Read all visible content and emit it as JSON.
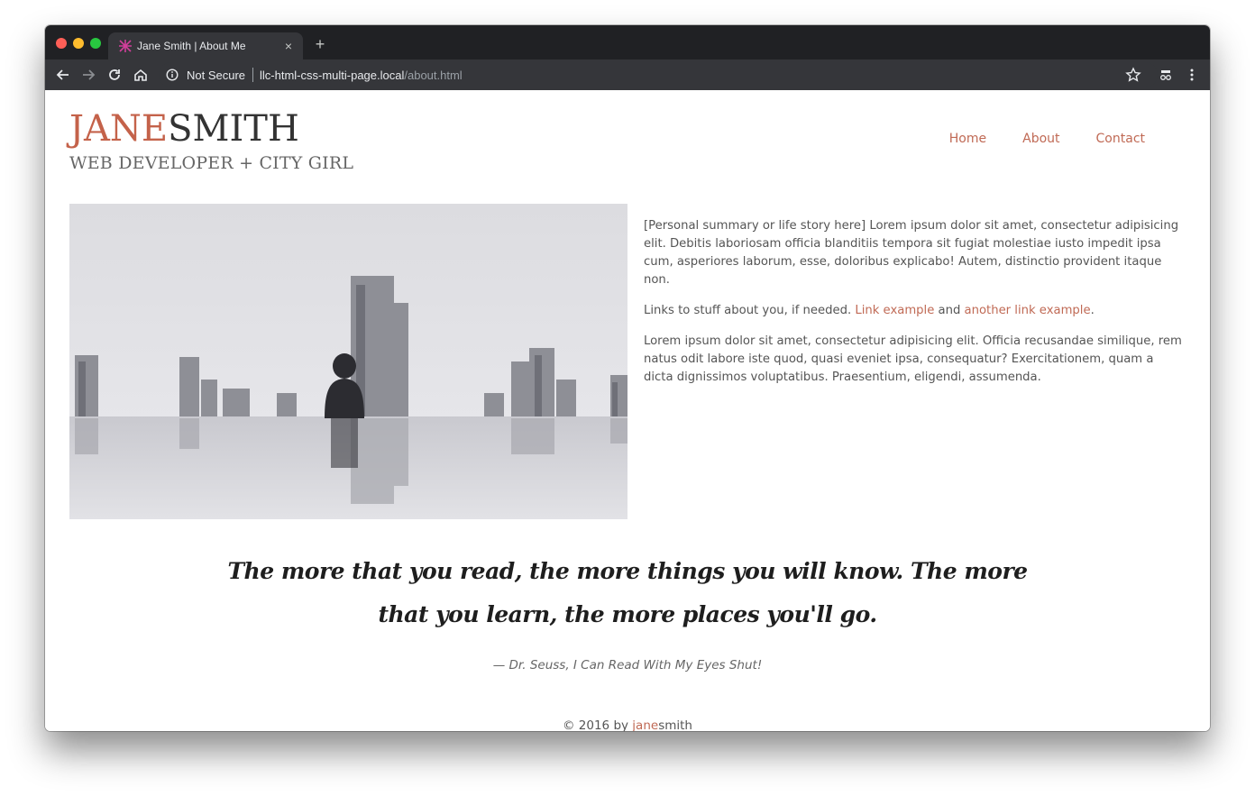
{
  "browser": {
    "tab_title": "Jane Smith | About Me",
    "tab_close": "×",
    "new_tab": "+",
    "security_label": "Not Secure",
    "url_host": "llc-html-css-multi-page.local",
    "url_path": "/about.html"
  },
  "site": {
    "logo_first": "JANE",
    "logo_last": "SMITH",
    "tagline": "WEB DEVELOPER + CITY GIRL",
    "nav": [
      "Home",
      "About",
      "Contact"
    ]
  },
  "bio": {
    "p1": "[Personal summary or life story here] Lorem ipsum dolor sit amet, consectetur adipisicing elit. Debitis laboriosam officia blanditiis tempora sit fugiat molestiae iusto impedit ipsa cum, asperiores laborum, esse, doloribus explicabo! Autem, distinctio provident itaque non.",
    "p2_prefix": "Links to stuff about you, if needed. ",
    "link1": "Link example",
    "p2_mid": " and ",
    "link2": "another link example",
    "p2_suffix": ".",
    "p3": "Lorem ipsum dolor sit amet, consectetur adipisicing elit. Officia recusandae similique, rem natus odit labore iste quod, quasi eveniet ipsa, consequatur? Exercitationem, quam a dicta dignissimos voluptatibus. Praesentium, eligendi, assumenda."
  },
  "quote": {
    "text": "The more that you read, the more things you will know. The more that you learn, the more places you'll go.",
    "cite": "— Dr. Seuss, I Can Read With My Eyes Shut!"
  },
  "footer": {
    "prefix": "© 2016 by ",
    "accent": "jane",
    "suffix": "smith"
  },
  "colors": {
    "accent": "#c06a55",
    "browser_dark": "#202124",
    "browser_toolbar": "#35363a"
  },
  "icons": [
    "back-arrow-icon",
    "forward-arrow-icon",
    "reload-icon",
    "home-icon",
    "info-icon",
    "star-icon",
    "extension-icon",
    "kebab-menu-icon",
    "tab-favicon"
  ]
}
